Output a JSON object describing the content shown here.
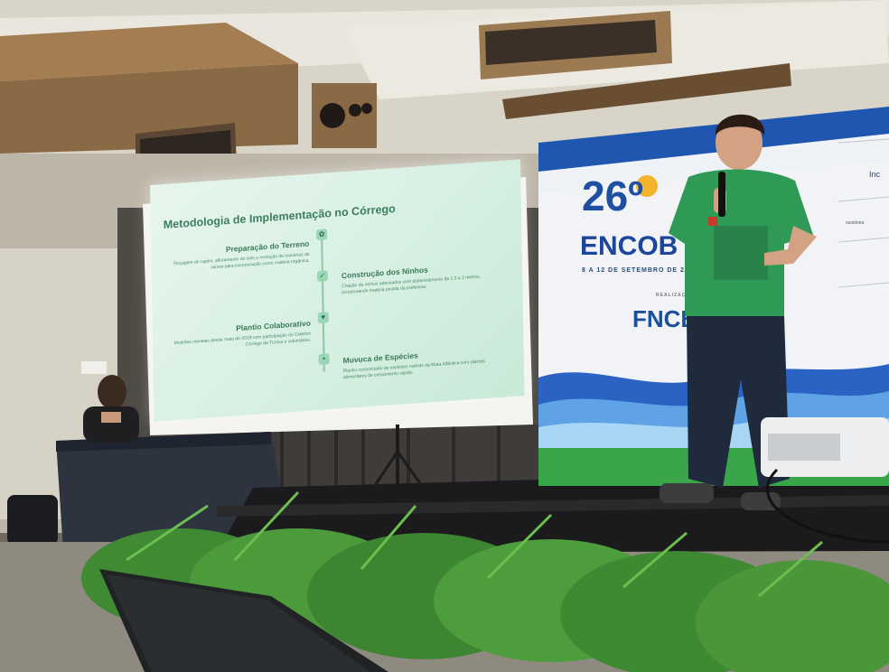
{
  "slide": {
    "title": "Metodologia de Implementação no Córrego",
    "steps": [
      {
        "heading": "Preparação do Terreno",
        "body": "Roçagem do capim, afloramento do solo e remoção de touceiras de raízes para incorporação como matéria orgânica."
      },
      {
        "heading": "Construção dos Ninhos",
        "body": "Criação de ninhos adensados com distanciamento de 1,5 a 3 metros, incorporando matéria picada da prefeitura."
      },
      {
        "heading": "Plantio Colaborativo",
        "body": "Mutirões mensais desde maio de 2019 com participação do Coletivo Córrego da Tímica e voluntários."
      },
      {
        "heading": "Muvuca de Espécies",
        "body": "Plantio consorciado de espécies nativas da Mata Atlântica com plantas alimentares de crescimento rápido."
      }
    ],
    "icons": [
      "leaf-icon",
      "sprout-icon",
      "heart-icon",
      "seed-icon"
    ]
  },
  "banner": {
    "number": "26º",
    "event": "ENCOB",
    "dates": "8 A 12 DE SETEMBRO DE 2",
    "realizacao": "REALIZAÇÃO",
    "organizer": "FNCBH",
    "sponsors": [
      "Inc",
      "ouvidoria"
    ]
  },
  "colors": {
    "slide_bg": "#d5efe1",
    "slide_accent": "#3c7d5a",
    "banner_blue": "#1f4fa0",
    "banner_green": "#3aa64a",
    "shirt_green": "#2f9a55"
  }
}
